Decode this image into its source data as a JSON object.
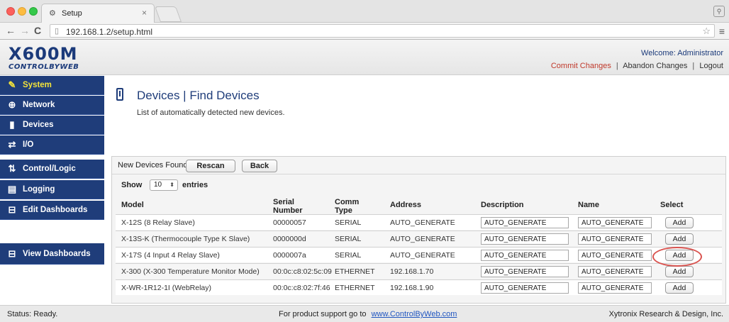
{
  "browser": {
    "tab_title": "Setup",
    "tab_close": "×",
    "url": "192.168.1.2/setup.html"
  },
  "header": {
    "logo_main": "X600M",
    "logo_sub": "CONTROLBYWEB",
    "welcome": "Welcome: Administrator",
    "commit_changes": "Commit Changes",
    "abandon_changes": "Abandon Changes",
    "logout": "Logout",
    "separator": "|"
  },
  "sidebar": {
    "items": [
      {
        "label": "System",
        "icon": "wrench-icon",
        "glyph": "🔧",
        "active": true
      },
      {
        "label": "Network",
        "icon": "globe-icon",
        "glyph": "⊕",
        "active": false
      },
      {
        "label": "Devices",
        "icon": "device-icon",
        "glyph": "▮",
        "active": false
      },
      {
        "label": "I/O",
        "icon": "arrows-icon",
        "glyph": "⇄",
        "active": false
      },
      {
        "label": "Control/Logic",
        "icon": "logic-icon",
        "glyph": "⇅",
        "active": false
      },
      {
        "label": "Logging",
        "icon": "document-icon",
        "glyph": "▤",
        "active": false
      },
      {
        "label": "Edit Dashboards",
        "icon": "dashboard-icon",
        "glyph": "⊟",
        "active": false
      },
      {
        "label": "View Dashboards",
        "icon": "dashboard-icon",
        "glyph": "⊟",
        "active": false
      }
    ]
  },
  "main": {
    "title": "Devices | Find Devices",
    "subtitle": "List of automatically detected new devices.",
    "panel_label": "New Devices Found",
    "rescan_label": "Rescan",
    "back_label": "Back",
    "show_label": "Show",
    "show_value": "10",
    "entries_label": "entries",
    "columns": {
      "model": "Model",
      "serial_1": "Serial",
      "serial_2": "Number",
      "comm_1": "Comm",
      "comm_2": "Type",
      "address": "Address",
      "description": "Description",
      "name": "Name",
      "select": "Select"
    },
    "rows": [
      {
        "model": "X-12S (8 Relay Slave)",
        "serial": "00000057",
        "comm": "SERIAL",
        "address": "AUTO_GENERATE",
        "description": "AUTO_GENERATE",
        "name": "AUTO_GENERATE",
        "add": "Add"
      },
      {
        "model": "X-13S-K (Thermocouple Type K Slave)",
        "serial": "0000000d",
        "comm": "SERIAL",
        "address": "AUTO_GENERATE",
        "description": "AUTO_GENERATE",
        "name": "AUTO_GENERATE",
        "add": "Add"
      },
      {
        "model": "X-17S (4 Input 4 Relay Slave)",
        "serial": "0000007a",
        "comm": "SERIAL",
        "address": "AUTO_GENERATE",
        "description": "AUTO_GENERATE",
        "name": "AUTO_GENERATE",
        "add": "Add"
      },
      {
        "model": "X-300 (X-300 Temperature Monitor Mode)",
        "serial": "00:0c:c8:02:5c:09",
        "comm": "ETHERNET",
        "address": "192.168.1.70",
        "description": "AUTO_GENERATE",
        "name": "AUTO_GENERATE",
        "add": "Add"
      },
      {
        "model": "X-WR-1R12-1I (WebRelay)",
        "serial": "00:0c:c8:02:7f:46",
        "comm": "ETHERNET",
        "address": "192.168.1.90",
        "description": "AUTO_GENERATE",
        "name": "AUTO_GENERATE",
        "add": "Add"
      }
    ]
  },
  "status": {
    "left": "Status:  Ready.",
    "center_text": "For product support go to",
    "center_link": "www.ControlByWeb.com",
    "right": "Xytronix Research & Design, Inc."
  },
  "colors": {
    "sidebar_bg": "#1f3d7a",
    "sidebar_active_text": "#f3e33a",
    "commit_link": "#c0392b",
    "highlight_ring": "#d9534f"
  }
}
